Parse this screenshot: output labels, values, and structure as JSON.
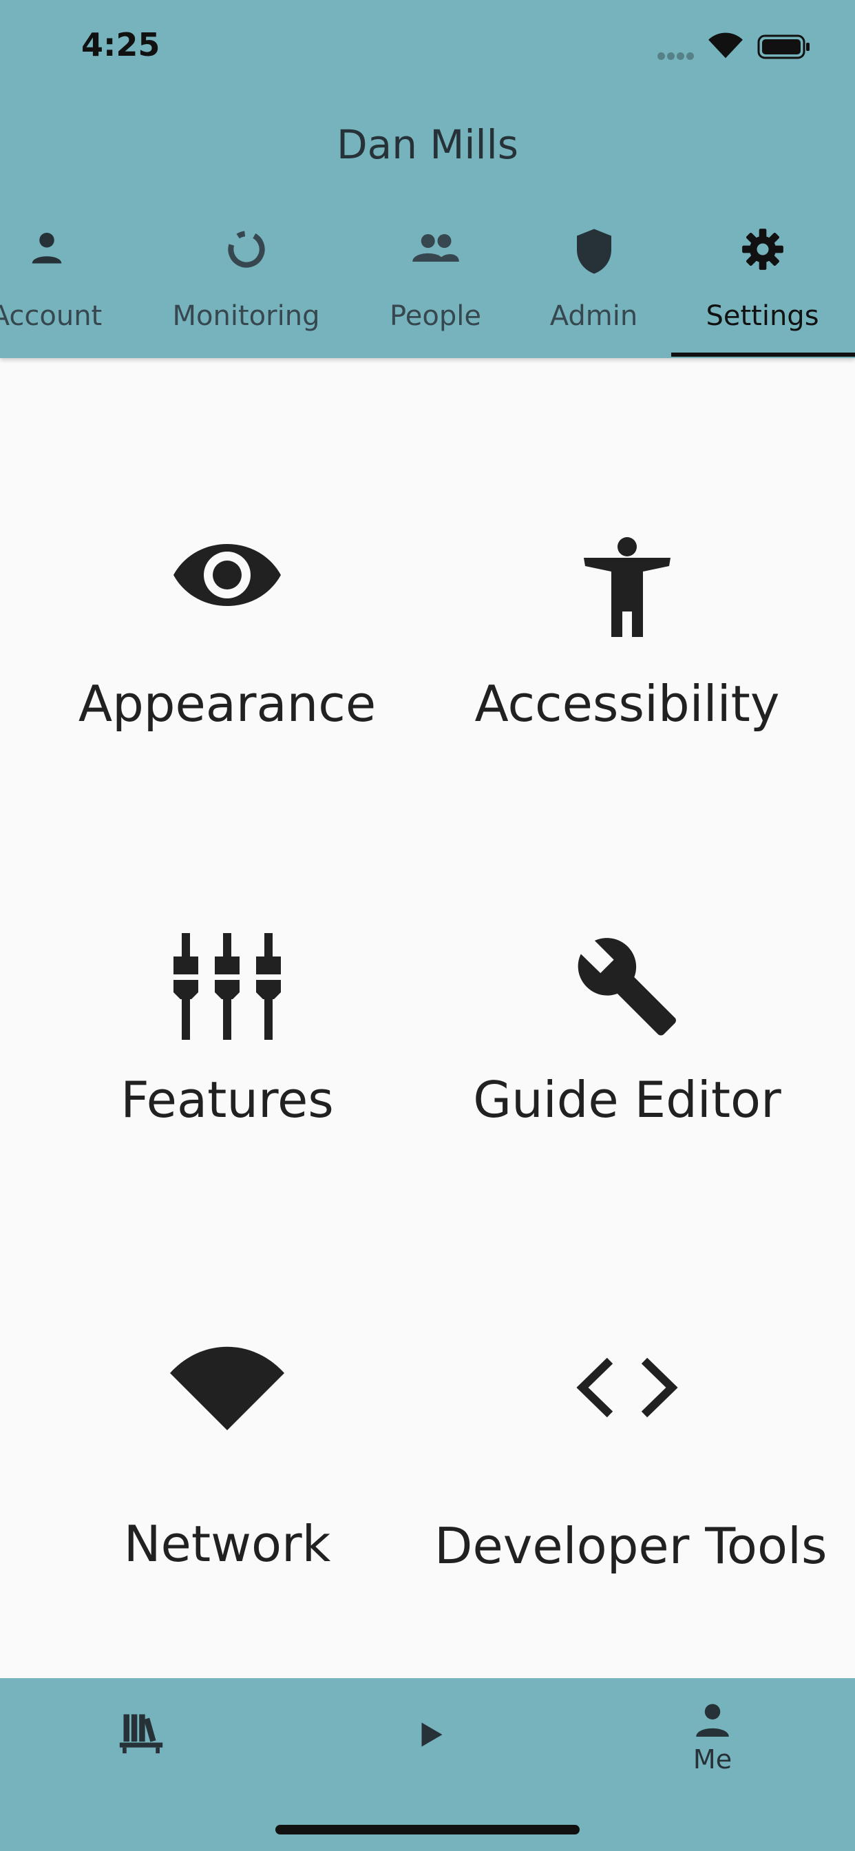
{
  "status_bar": {
    "time": "4:25",
    "wifi_icon": "wifi-icon",
    "battery_icon": "battery-icon"
  },
  "header": {
    "title": "Dan Mills"
  },
  "tabs": [
    {
      "label": "Account",
      "icon": "person-icon"
    },
    {
      "label": "Monitoring",
      "icon": "progress-ring-icon"
    },
    {
      "label": "People",
      "icon": "people-icon"
    },
    {
      "label": "Admin",
      "icon": "shield-icon"
    },
    {
      "label": "Settings",
      "icon": "gear-icon",
      "selected": true
    }
  ],
  "tiles": [
    {
      "label": "Appearance",
      "icon": "eye-icon"
    },
    {
      "label": "Accessibility",
      "icon": "accessibility-icon"
    },
    {
      "label": "Features",
      "icon": "plugs-icon"
    },
    {
      "label": "Guide Editor",
      "icon": "wrench-icon"
    },
    {
      "label": "Network",
      "icon": "wifi-wedge-icon"
    },
    {
      "label": "Developer Tools",
      "icon": "code-icon"
    }
  ],
  "bottom_nav": [
    {
      "label": "",
      "icon": "library-icon"
    },
    {
      "label": "",
      "icon": "play-icon"
    },
    {
      "label": "Me",
      "icon": "person-icon",
      "selected": true
    }
  ],
  "colors": {
    "accent": "#76b3bc",
    "background": "#fafafa",
    "text": "#212121"
  }
}
